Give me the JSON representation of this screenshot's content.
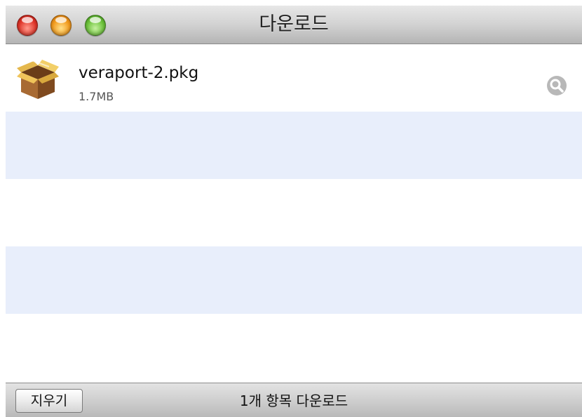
{
  "window": {
    "title": "다운로드"
  },
  "downloads": [
    {
      "name": "veraport-2.pkg",
      "size": "1.7MB",
      "icon": "package-icon",
      "action_icon": "magnifier-icon"
    }
  ],
  "statusbar": {
    "clear_label": "지우기",
    "summary": "1개 항목 다운로드"
  },
  "colors": {
    "alternate_row": "#e8eefb",
    "close": "#e0362a",
    "minimize": "#f29a1d",
    "zoom": "#6cc23a"
  }
}
